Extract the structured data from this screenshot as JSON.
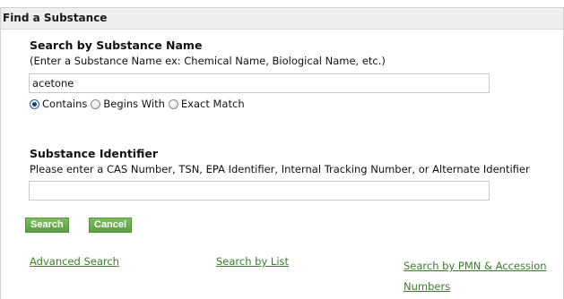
{
  "panel": {
    "title": "Find a Substance"
  },
  "name_search": {
    "title": "Search by Substance Name",
    "help": "(Enter a Substance Name ex: Chemical Name, Biological Name, etc.)",
    "value": "acetone",
    "options": [
      "Contains",
      "Begins With",
      "Exact Match"
    ],
    "selected": "Contains"
  },
  "identifier_search": {
    "title": "Substance Identifier",
    "help": "Please enter a CAS Number, TSN, EPA Identifier, Internal Tracking Number, or Alternate Identifier",
    "value": ""
  },
  "buttons": {
    "search": "Search",
    "cancel": "Cancel"
  },
  "links": {
    "advanced": "Advanced Search",
    "by_list": "Search by List",
    "by_pmn_line1": "Search by PMN & Accession",
    "by_pmn_line2": "Numbers"
  },
  "colors": {
    "button_green": "#6aa84f",
    "link_green": "#3a7d2c",
    "header_bg": "#eeeeee"
  }
}
